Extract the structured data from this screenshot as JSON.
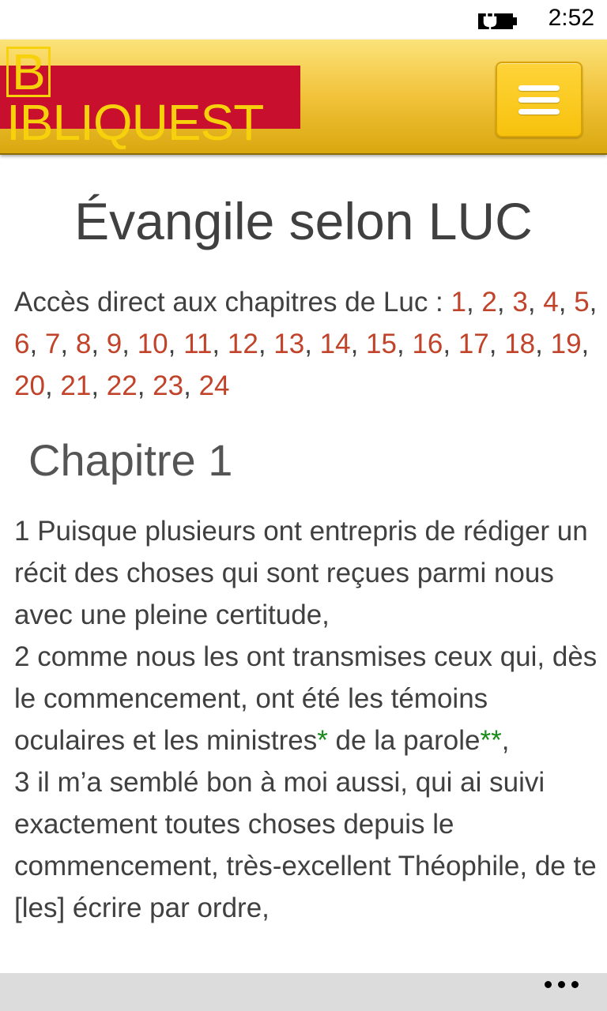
{
  "status_bar": {
    "time": "2:52",
    "battery_icon": "battery-charging-icon"
  },
  "header": {
    "logo_first_letter": "B",
    "logo_rest": "IBLIQUEST",
    "menu_icon": "hamburger-menu-icon",
    "colors": {
      "logo_bg": "#c8102e",
      "logo_text": "#f7d10b",
      "header_gold": "#f2c23a"
    }
  },
  "page": {
    "title": "Évangile selon LUC",
    "chapters_intro": "Accès direct aux chapitres de Luc : ",
    "chapters": [
      "1",
      "2",
      "3",
      "4",
      "5",
      "6",
      "7",
      "8",
      "9",
      "10",
      "11",
      "12",
      "13",
      "14",
      "15",
      "16",
      "17",
      "18",
      "19",
      "20",
      "21",
      "22",
      "23",
      "24"
    ],
    "chapter_heading": "Chapitre 1",
    "link_color": "#c0432a",
    "note_color": "#1a8a1a"
  },
  "verses": {
    "v1": "1 Puisque plusieurs ont entrepris de rédiger un récit des choses qui sont reçues parmi nous avec une pleine certitude,",
    "v2_a": "2 comme nous les ont transmises ceux qui, dès le commencement, ont été les témoins oculaires et les ministres",
    "v2_note1": "*",
    "v2_b": " de la parole",
    "v2_note2": "**",
    "v2_c": ",",
    "v3": "3 il m’a semblé bon à moi aussi, qui ai suivi exactement toutes choses depuis le commencement, très-excellent Théophile, de te [les] écrire par ordre,"
  },
  "app_bar": {
    "more_icon": "more-ellipsis-icon"
  }
}
